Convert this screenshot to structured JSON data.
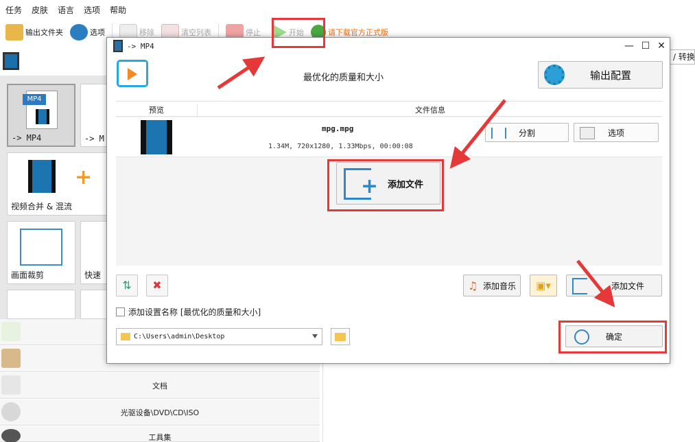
{
  "menu": [
    "任务",
    "皮肤",
    "语言",
    "选项",
    "帮助"
  ],
  "toolbar": {
    "output_folder": "输出文件夹",
    "options": "选项",
    "remove": "移除",
    "clear_list": "清空列表",
    "stop": "停止",
    "start": "开始",
    "download": "请下载官方正式版"
  },
  "tiles": {
    "mp4": "-> MP4",
    "mp4_badge": "MP4",
    "m2": "-> M",
    "merge": "视频合并 & 混流",
    "crop": "画面裁剪",
    "quick": "快速"
  },
  "categories": {
    "doc": "文档",
    "optical": "光驱设备\\DVD\\CD\\ISO",
    "tools": "工具集"
  },
  "right_fragment": "/ 转换",
  "dialog": {
    "title": "-> MP4",
    "header": "最优化的质量和大小",
    "output_config": "输出配置",
    "col_preview": "预览",
    "col_info": "文件信息",
    "file_name": "mpg.mpg",
    "file_info": "1.34M, 720x1280, 1.33Mbps, 00:00:08",
    "split": "分割",
    "option": "选项",
    "add_file_big": "添加文件",
    "add_music": "添加音乐",
    "add_file_small": "添加文件",
    "checkbox_label": "添加设置名称 [最优化的质量和大小]",
    "path": "C:\\Users\\admin\\Desktop",
    "confirm": "确定"
  },
  "colors": {
    "accent_blue": "#2e87c8",
    "annotation_red": "#e53838",
    "download_orange": "#e8711d"
  }
}
